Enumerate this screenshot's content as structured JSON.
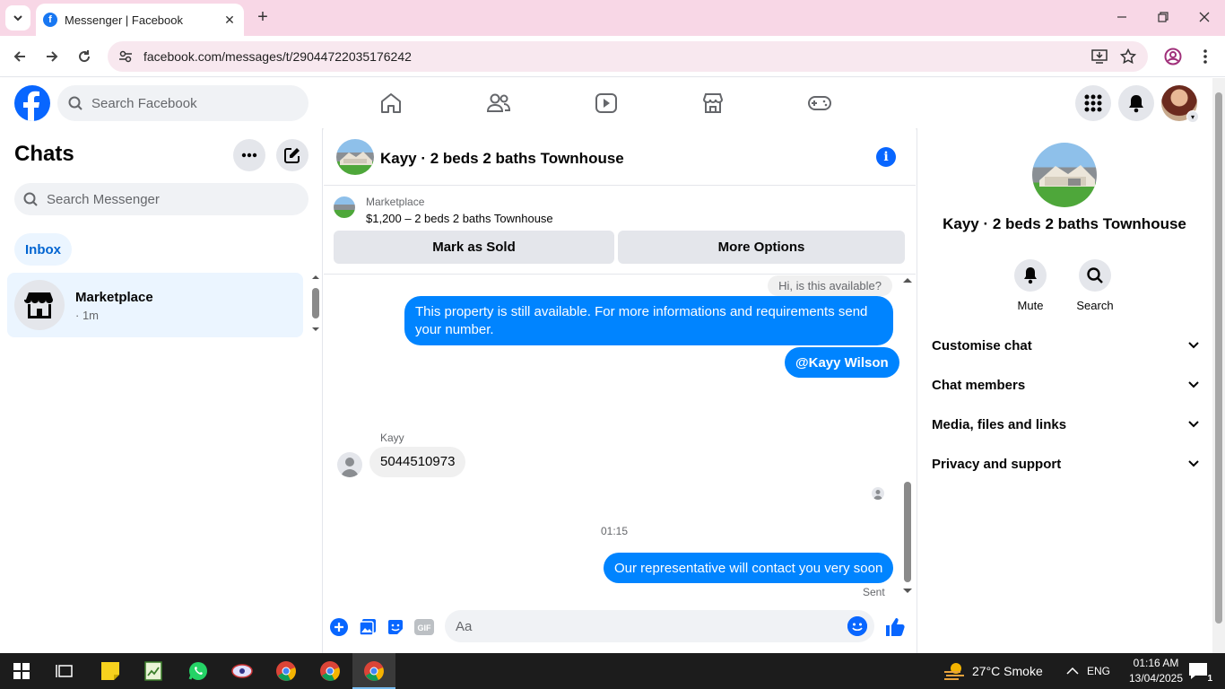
{
  "browser": {
    "tab_title": "Messenger | Facebook",
    "url": "facebook.com/messages/t/29044722035176242"
  },
  "fb_header": {
    "search_placeholder": "Search Facebook"
  },
  "chats": {
    "title": "Chats",
    "search_placeholder": "Search Messenger",
    "inbox_label": "Inbox",
    "items": [
      {
        "name": "Marketplace",
        "sub": "· 1m"
      }
    ]
  },
  "conversation": {
    "title": "Kayy · 2 beds 2 baths Townhouse",
    "marketplace_label": "Marketplace",
    "listing": "$1,200 – 2 beds 2 baths Townhouse",
    "mark_sold_label": "Mark as Sold",
    "more_options_label": "More Options",
    "reply_snippet": "Hi, is this available?",
    "messages": {
      "out1": "This property is still available. For more informations and requirements send your number.",
      "out2": "@Kayy Wilson",
      "in_sender": "Kayy",
      "in1": "5044510973",
      "timestamp": "01:15",
      "out3": "Our representative will contact you very soon",
      "status": "Sent"
    },
    "composer_placeholder": "Aa",
    "gif_label": "GIF"
  },
  "details": {
    "title": "Kayy · 2 beds 2 baths Townhouse",
    "mute_label": "Mute",
    "search_label": "Search",
    "sections": [
      "Customise chat",
      "Chat members",
      "Media, files and links",
      "Privacy and support"
    ]
  },
  "taskbar": {
    "weather": "27°C  Smoke",
    "language": "ENG",
    "time": "01:16 AM",
    "date": "13/04/2025",
    "notif_count": "1"
  },
  "colors": {
    "brand": "#0866ff",
    "bubble_out": "#0084ff",
    "tab_bar": "#f8d7e6"
  }
}
